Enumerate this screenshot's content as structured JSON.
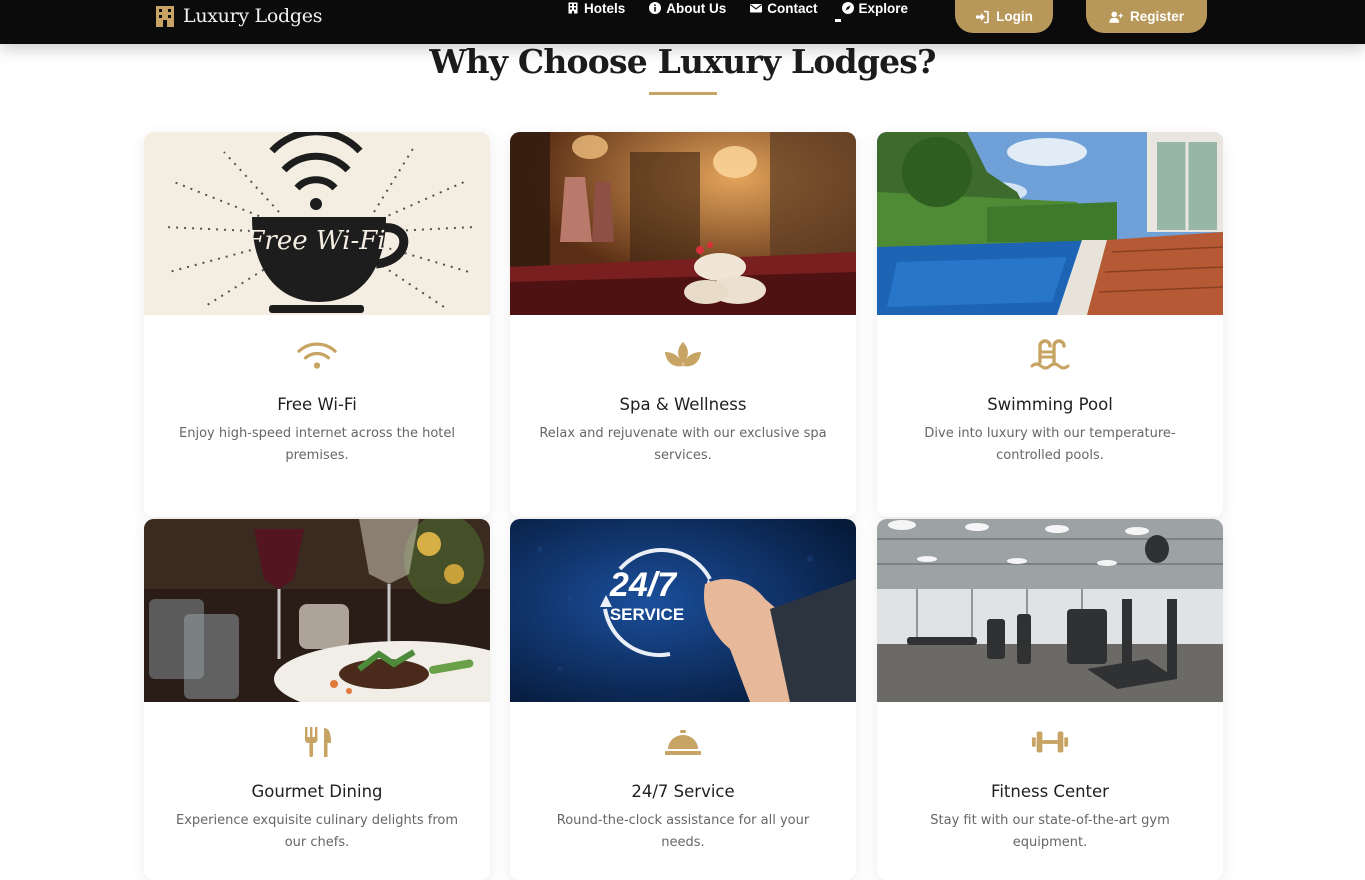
{
  "brand": {
    "name": "Luxury Lodges",
    "icon": "hotel-building-icon"
  },
  "nav": {
    "links": [
      {
        "label": "Hotels",
        "icon": "hotel-icon"
      },
      {
        "label": "About Us",
        "icon": "info-icon"
      },
      {
        "label": "Contact",
        "icon": "envelope-icon"
      },
      {
        "label": "Explore",
        "icon": "compass-icon"
      }
    ],
    "login_label": "Login",
    "register_label": "Register"
  },
  "section": {
    "title": "Why Choose Luxury Lodges?"
  },
  "colors": {
    "accent": "#c7a464",
    "button": "#b8985a",
    "navbar": "#0b0b0b"
  },
  "features": [
    {
      "title": "Free Wi-Fi",
      "description": "Enjoy high-speed internet across the hotel premises.",
      "icon": "wifi-icon",
      "image_text": "Free Wi-Fi"
    },
    {
      "title": "Spa & Wellness",
      "description": "Relax and rejuvenate with our exclusive spa services.",
      "icon": "spa-lotus-icon"
    },
    {
      "title": "Swimming Pool",
      "description": "Dive into luxury with our temperature-controlled pools.",
      "icon": "swimming-pool-icon"
    },
    {
      "title": "Gourmet Dining",
      "description": "Experience exquisite culinary delights from our chefs.",
      "icon": "utensils-icon"
    },
    {
      "title": "24/7 Service",
      "description": "Round-the-clock assistance for all your needs.",
      "icon": "concierge-bell-icon",
      "image_text_top": "24/7",
      "image_text_bottom": "SERVICE"
    },
    {
      "title": "Fitness Center",
      "description": "Stay fit with our state-of-the-art gym equipment.",
      "icon": "dumbbell-icon"
    }
  ]
}
